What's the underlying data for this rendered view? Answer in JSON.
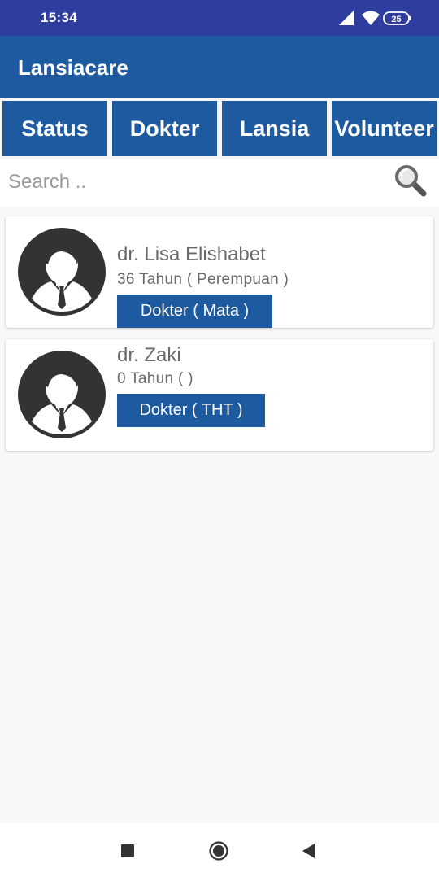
{
  "status_bar": {
    "time": "15:34",
    "battery": "25"
  },
  "app_bar": {
    "title": "Lansiacare"
  },
  "tabs": [
    {
      "label": "Status"
    },
    {
      "label": "Dokter"
    },
    {
      "label": "Lansia"
    },
    {
      "label": "Volunteer"
    }
  ],
  "search": {
    "placeholder": "Search .."
  },
  "doctors": [
    {
      "name": "dr. Lisa Elishabet",
      "info": "36 Tahun ( Perempuan )",
      "specialty": "Dokter ( Mata )"
    },
    {
      "name": "dr. Zaki",
      "info": "0 Tahun (  )",
      "specialty": "Dokter ( THT )"
    }
  ],
  "colors": {
    "status_bar": "#2f3d9e",
    "primary": "#1e5aa0",
    "background": "#f8f8f8"
  },
  "icons": {
    "search": "magnifier-icon",
    "avatar": "person-silhouette-icon",
    "nav": [
      "recents-square-icon",
      "home-circle-icon",
      "back-triangle-icon"
    ]
  }
}
